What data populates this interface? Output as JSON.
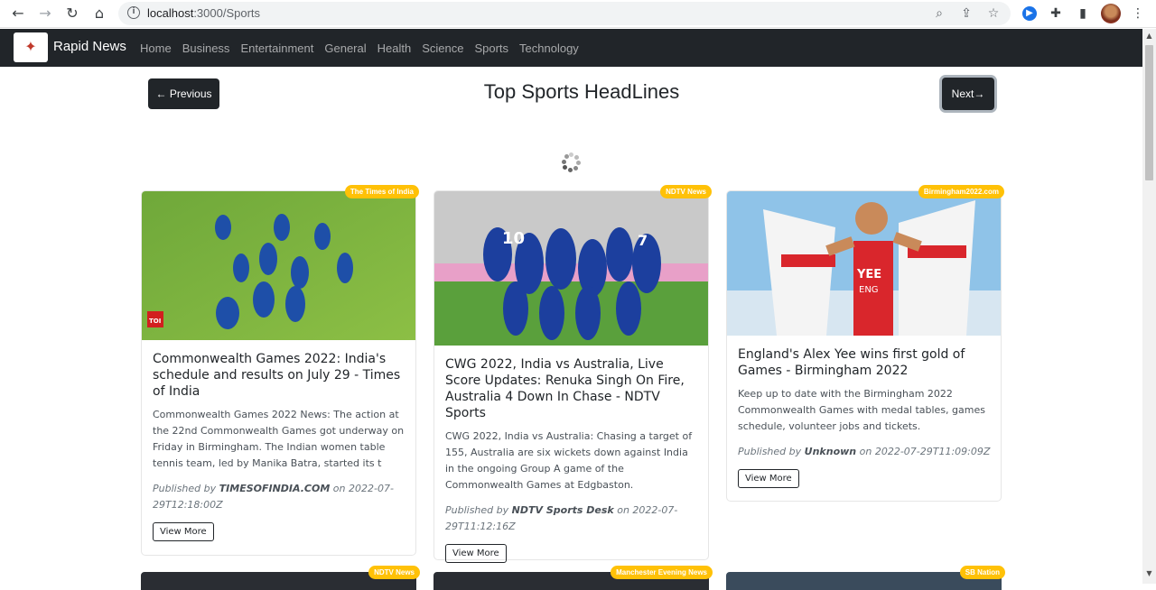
{
  "browser": {
    "url_host": "localhost",
    "url_rest": ":3000/Sports"
  },
  "navbar": {
    "brand": "Rapid News",
    "links": [
      "Home",
      "Business",
      "Entertainment",
      "General",
      "Health",
      "Science",
      "Sports",
      "Technology"
    ]
  },
  "page": {
    "title": "Top Sports HeadLines",
    "prev_label": "← Previous",
    "next_label": "Next→"
  },
  "articles": [
    {
      "source": "The Times of India",
      "title": "Commonwealth Games 2022: India's schedule and results on July 29 - Times of India",
      "description": "Commonwealth Games 2022 News: The action at the 22nd Commonwealth Games got underway on Friday in Birmingham. The Indian women table tennis team, led by Manika Batra, started its t",
      "published_prefix": "Published by",
      "author": "TIMESOFINDIA.COM",
      "date_prefix": "on",
      "date": "2022-07-29T12:18:00Z",
      "button": "View More"
    },
    {
      "source": "NDTV News",
      "title": "CWG 2022, India vs Australia, Live Score Updates: Renuka Singh On Fire, Australia 4 Down In Chase - NDTV Sports",
      "description": "CWG 2022, India vs Australia: Chasing a target of 155, Australia are six wickets down against India in the ongoing Group A game of the Commonwealth Games at Edgbaston.",
      "published_prefix": "Published by",
      "author": "NDTV Sports Desk",
      "date_prefix": "on",
      "date": "2022-07-29T11:12:16Z",
      "button": "View More"
    },
    {
      "source": "Birmingham2022.com",
      "title": "England's Alex Yee wins first gold of Games - Birmingham 2022",
      "description": "Keep up to date with the Birmingham 2022 Commonwealth Games with medal tables, games schedule, volunteer jobs and tickets.",
      "published_prefix": "Published by",
      "author": "Unknown",
      "date_prefix": "on",
      "date": "2022-07-29T11:09:09Z",
      "button": "View More"
    }
  ],
  "next_row_sources": [
    "NDTV News",
    "Manchester Evening News",
    "SB Nation"
  ],
  "colors": {
    "navbar": "#212529",
    "badge": "#ffc107"
  }
}
